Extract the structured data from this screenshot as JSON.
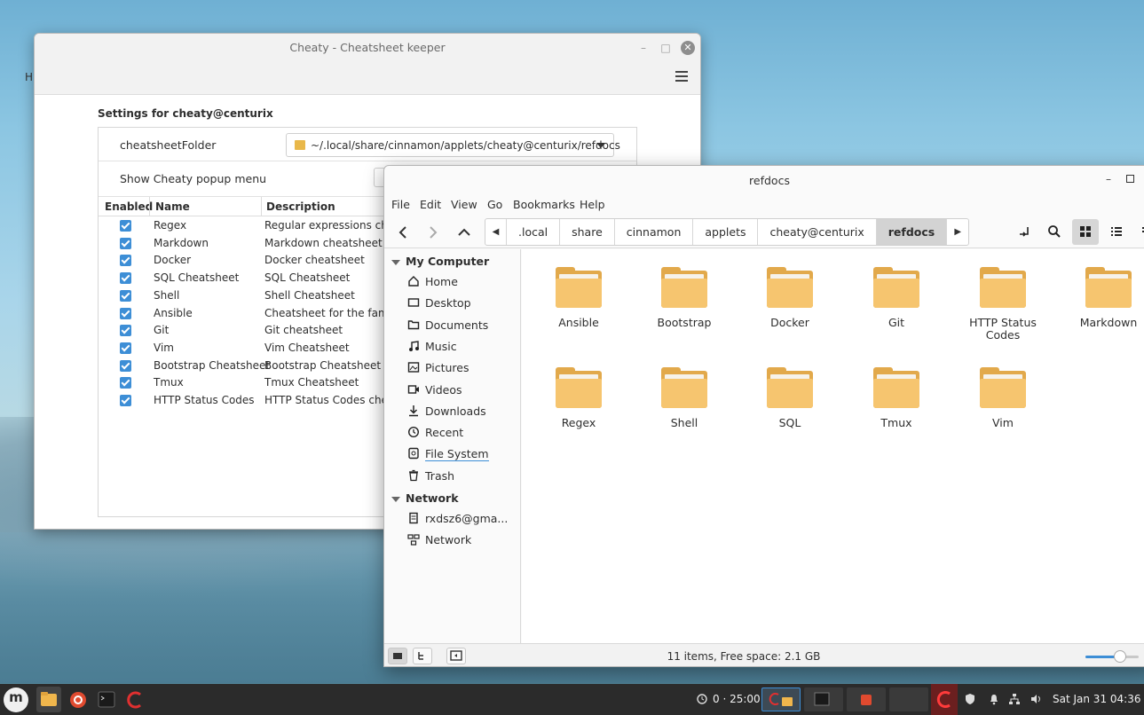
{
  "desktop": {
    "fragment_text": "H"
  },
  "cheaty": {
    "title": "Cheaty - Cheatsheet keeper",
    "settings_title": "Settings for cheaty@centurix",
    "folder_label": "cheatsheetFolder",
    "folder_value": "~/.local/share/cinnamon/applets/cheaty@centurix/refdocs",
    "popup_label": "Show Cheaty popup menu",
    "columns": [
      "Enabled",
      "Name",
      "Description"
    ],
    "rows": [
      {
        "name": "Regex",
        "desc": "Regular expressions chea",
        "enabled": true
      },
      {
        "name": "Markdown",
        "desc": "Markdown cheatsheet",
        "enabled": true
      },
      {
        "name": "Docker",
        "desc": "Docker cheatsheet",
        "enabled": true
      },
      {
        "name": "SQL Cheatsheet",
        "desc": "SQL Cheatsheet",
        "enabled": true
      },
      {
        "name": "Shell",
        "desc": "Shell Cheatsheet",
        "enabled": true
      },
      {
        "name": "Ansible",
        "desc": "Cheatsheet for the famou",
        "enabled": true
      },
      {
        "name": "Git",
        "desc": "Git cheatsheet",
        "enabled": true
      },
      {
        "name": "Vim",
        "desc": "Vim Cheatsheet",
        "enabled": true
      },
      {
        "name": "Bootstrap Cheatsheet",
        "desc": "Bootstrap Cheatsheet",
        "enabled": true
      },
      {
        "name": "Tmux",
        "desc": "Tmux Cheatsheet",
        "enabled": true
      },
      {
        "name": "HTTP Status Codes",
        "desc": "HTTP Status Codes cheat",
        "enabled": true
      }
    ]
  },
  "nemo": {
    "title": "refdocs",
    "menu": [
      "File",
      "Edit",
      "View",
      "Go",
      "Bookmarks",
      "Help"
    ],
    "breadcrumbs": [
      ".local",
      "share",
      "cinnamon",
      "applets",
      "cheaty@centurix",
      "refdocs"
    ],
    "sidebar": {
      "my_computer": "My Computer",
      "places": [
        {
          "label": "Home",
          "icon": "home-icon"
        },
        {
          "label": "Desktop",
          "icon": "desktop-icon"
        },
        {
          "label": "Documents",
          "icon": "documents-icon"
        },
        {
          "label": "Music",
          "icon": "music-icon"
        },
        {
          "label": "Pictures",
          "icon": "pictures-icon"
        },
        {
          "label": "Videos",
          "icon": "videos-icon"
        },
        {
          "label": "Downloads",
          "icon": "downloads-icon"
        },
        {
          "label": "Recent",
          "icon": "recent-icon"
        },
        {
          "label": "File System",
          "icon": "filesystem-icon"
        },
        {
          "label": "Trash",
          "icon": "trash-icon"
        }
      ],
      "network_header": "Network",
      "network": [
        {
          "label": "rxdsz6@gma...",
          "icon": "drive-icon"
        },
        {
          "label": "Network",
          "icon": "network-icon"
        }
      ]
    },
    "files": [
      "Ansible",
      "Bootstrap",
      "Docker",
      "Git",
      "HTTP Status Codes",
      "Markdown",
      "Regex",
      "Shell",
      "SQL",
      "Tmux",
      "Vim"
    ],
    "status": "11 items, Free space: 2.1 GB",
    "zoom_level": 0.65
  },
  "taskbar": {
    "timer": "0 · 25:00",
    "clock": "Sat Jan 31 04:36"
  },
  "colors": {
    "accent": "#3d8ed6",
    "folder": "#f6c56f",
    "taskbar": "#2b2b2b"
  }
}
